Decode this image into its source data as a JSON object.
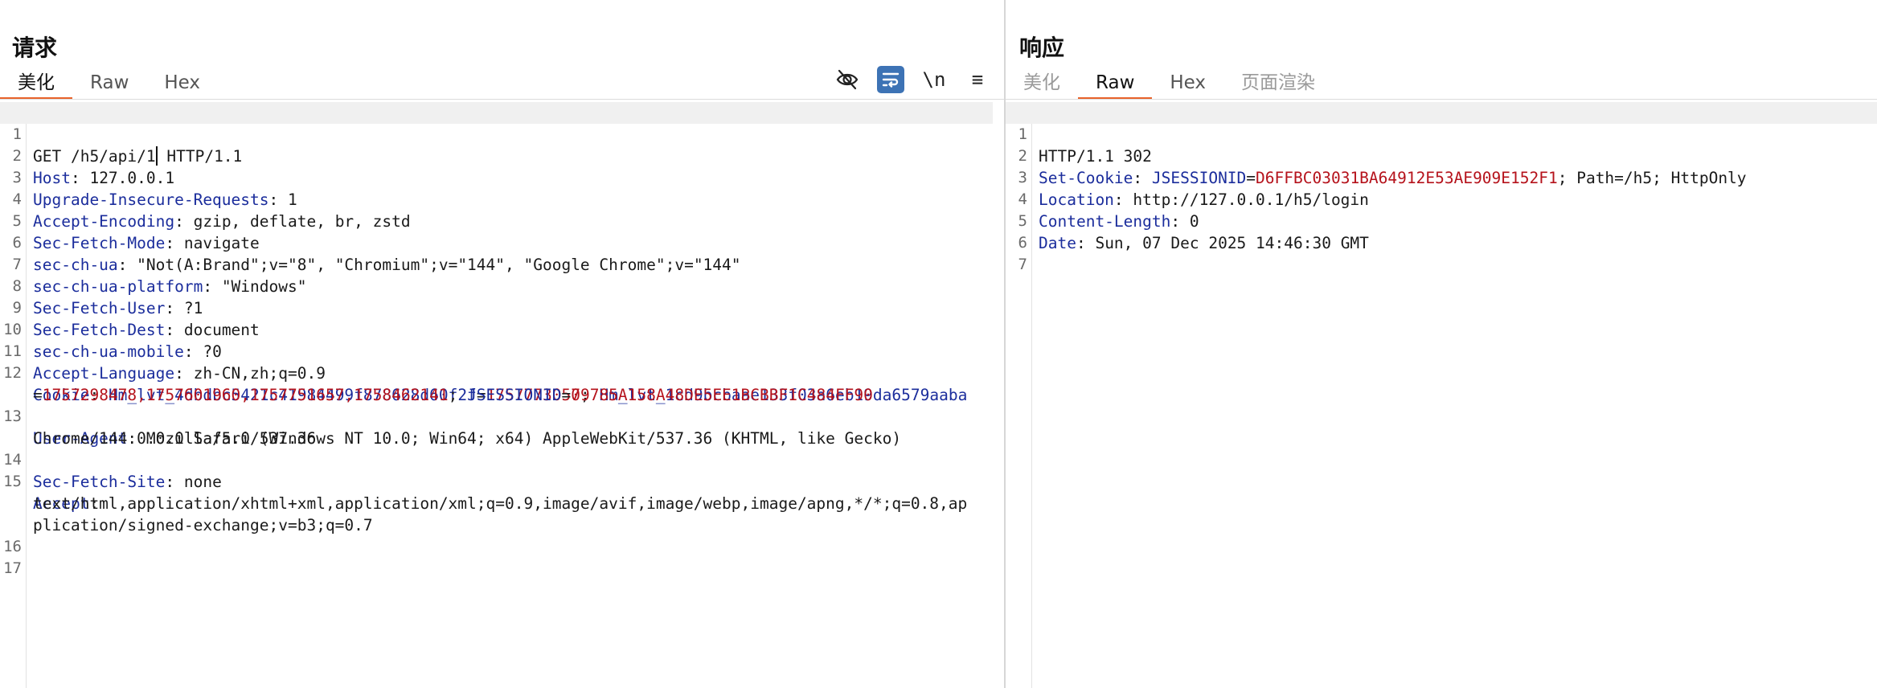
{
  "request": {
    "title": "请求",
    "tabs": [
      "美化",
      "Raw",
      "Hex"
    ],
    "active_tab": "美化",
    "toolbar": [
      {
        "name": "hide-non-printable-icon",
        "label": ""
      },
      {
        "name": "wrap-lines-icon",
        "label": ""
      },
      {
        "name": "newline-toggle-icon",
        "label": "\\n"
      },
      {
        "name": "menu-icon",
        "label": "≡"
      }
    ],
    "line_numbers": [
      "1",
      "2",
      "3",
      "4",
      "5",
      "6",
      "7",
      "8",
      "9",
      "10",
      "11",
      "12",
      "13",
      "14",
      "15",
      "16",
      "17"
    ],
    "request_line_method_path": "GET /h5/api/1",
    "request_line_version": " HTTP/1.1",
    "headers": [
      {
        "key": "Host",
        "value": "127.0.0.1"
      },
      {
        "key": "Upgrade-Insecure-Requests",
        "value": "1"
      },
      {
        "key": "Accept-Encoding",
        "value": "gzip, deflate, br, zstd"
      },
      {
        "key": "Sec-Fetch-Mode",
        "value": "navigate"
      },
      {
        "key": "sec-ch-ua",
        "value": "\"Not(A:Brand\";v=\"8\", \"Chromium\";v=\"144\", \"Google Chrome\";v=\"144\""
      },
      {
        "key": "sec-ch-ua-platform",
        "value": "\"Windows\""
      },
      {
        "key": "Sec-Fetch-User",
        "value": "?1"
      },
      {
        "key": "Sec-Fetch-Dest",
        "value": "document"
      },
      {
        "key": "sec-ch-ua-mobile",
        "value": "?0"
      },
      {
        "key": "Accept-Language",
        "value": "zh-CN,zh;q=0.9"
      }
    ],
    "cookie": {
      "key": "Cookie",
      "c1_name": "Hm_lvt_4dbdbc5421c41984499f878628d60f2f",
      "c1_value": "1757773050",
      "c2_name": "Hm_lvt_1cd9bcbaae133f03a6eb19da6579aaba",
      "c2_value": "1757298478,1757601960,1757751657,1758462141",
      "c3_name": "JSESSIONID",
      "c3_value": "79785A158A48DE5EE1BCBBF1C484FF90"
    },
    "user_agent": {
      "key": "User-Agent",
      "line1": "Mozilla/5.0 (Windows NT 10.0; Win64; x64) AppleWebKit/537.36 (KHTML, like Gecko)",
      "line2": "Chrome/144.0.0.0 Safari/537.36"
    },
    "fetch_site": {
      "key": "Sec-Fetch-Site",
      "value": "none"
    },
    "accept": {
      "key": "Accept",
      "line1": "text/html,application/xhtml+xml,application/xml;q=0.9,image/avif,image/webp,image/apng,*/*;q=0.8,ap",
      "line2": "plication/signed-exchange;v=b3;q=0.7"
    }
  },
  "response": {
    "title": "响应",
    "tabs": [
      "美化",
      "Raw",
      "Hex",
      "页面渲染"
    ],
    "active_tab": "Raw",
    "line_numbers": [
      "1",
      "2",
      "3",
      "4",
      "5",
      "6",
      "7"
    ],
    "status_line": "HTTP/1.1 302",
    "set_cookie": {
      "key": "Set-Cookie",
      "name": "JSESSIONID",
      "value": "D6FFBC03031BA64912E53AE909E152F1",
      "attrs": "; Path=/h5; HttpOnly"
    },
    "headers": [
      {
        "key": "Location",
        "value": "http://127.0.0.1/h5/login"
      },
      {
        "key": "Content-Length",
        "value": "0"
      },
      {
        "key": "Date",
        "value": "Sun, 07 Dec 2025 14:46:30 GMT"
      }
    ]
  },
  "colors": {
    "header_key": "#1b2d9c",
    "cookie_value": "#b5121b",
    "tab_underline": "#e8632b",
    "active_tool_bg": "#3d73b5"
  }
}
